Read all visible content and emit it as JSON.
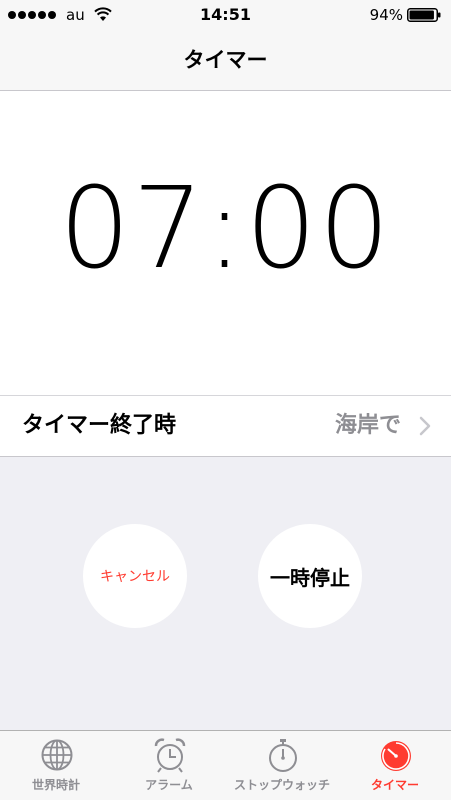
{
  "status_bar": {
    "carrier": "au",
    "time": "14:51",
    "battery_percent": "94%",
    "battery_level": 0.94,
    "signal_bars": 5
  },
  "nav": {
    "title": "タイマー"
  },
  "timer": {
    "minutes": "07",
    "separator": ":",
    "seconds": "00"
  },
  "end_action": {
    "label": "タイマー終了時",
    "value": "海岸で"
  },
  "controls": {
    "cancel_label": "キャンセル",
    "pause_label": "一時停止"
  },
  "tabs": [
    {
      "label": "世界時計",
      "icon": "globe-icon",
      "active": false
    },
    {
      "label": "アラーム",
      "icon": "alarm-clock-icon",
      "active": false
    },
    {
      "label": "ストップウォッチ",
      "icon": "stopwatch-icon",
      "active": false
    },
    {
      "label": "タイマー",
      "icon": "timer-icon",
      "active": true
    }
  ],
  "colors": {
    "accent": "#ff3b30",
    "inactive": "#8e8e93",
    "bar_background": "#f7f7f7",
    "controls_background": "#efeff4"
  }
}
